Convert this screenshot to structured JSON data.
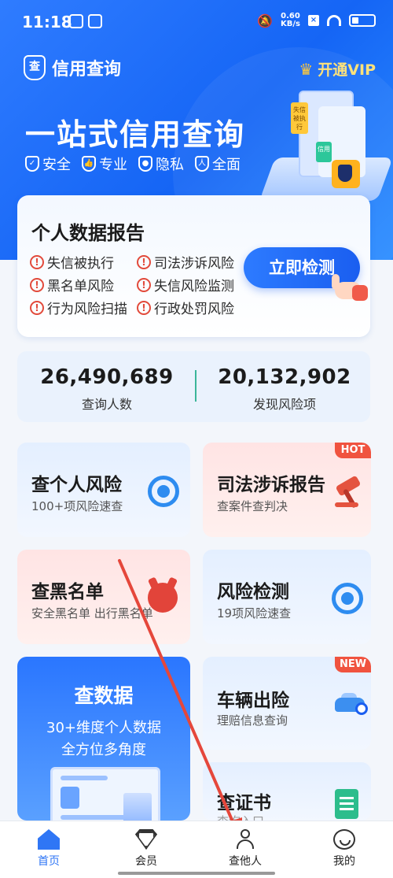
{
  "status_bar": {
    "time": "11:18",
    "speed_value": "0.60",
    "speed_unit": "KB/s"
  },
  "header": {
    "brand_name": "信用查询",
    "vip_label": "开通VIP"
  },
  "hero": {
    "headline": "一站式信用查询",
    "features": [
      "安全",
      "专业",
      "隐私",
      "全面"
    ],
    "illustration_tags": [
      "失信被执行",
      "信用"
    ]
  },
  "report_card": {
    "title": "个人数据报告",
    "risks": [
      "失信被执行",
      "司法涉诉风险",
      "黑名单风险",
      "失信风险监测",
      "行为风险扫描",
      "行政处罚风险"
    ],
    "button_label": "立即检测"
  },
  "stats": [
    {
      "value": "26,490,689",
      "label": "查询人数"
    },
    {
      "value": "20,132,902",
      "label": "发现风险项"
    }
  ],
  "tiles": {
    "personal_risk": {
      "title": "查个人风险",
      "subtitle": "100+项风险速查"
    },
    "judicial": {
      "title": "司法涉诉报告",
      "subtitle": "查案件查判决",
      "badge": "HOT"
    },
    "blacklist": {
      "title": "查黑名单",
      "subtitle": "安全黑名单 出行黑名单"
    },
    "risk_detect": {
      "title": "风险检测",
      "subtitle": "19项风险速查"
    },
    "data": {
      "title": "查数据",
      "line1": "30+维度个人数据",
      "line2": "全方位多角度"
    },
    "vehicle": {
      "title": "车辆出险",
      "subtitle": "理赔信息查询",
      "badge": "NEW"
    },
    "certificate": {
      "title": "查证书",
      "subtitle": "查询入口"
    }
  },
  "bottom_nav": [
    {
      "label": "首页",
      "icon": "home-icon",
      "active": true
    },
    {
      "label": "会员",
      "icon": "vip-diamond-icon",
      "active": false
    },
    {
      "label": "查他人",
      "icon": "person-icon",
      "active": false
    },
    {
      "label": "我的",
      "icon": "smile-face-icon",
      "active": false
    }
  ],
  "colors": {
    "primary": "#1565f5",
    "accent_red": "#e24a3b",
    "vip_gold": "#ffe27a",
    "annotation_arrow": "#e5473b"
  }
}
